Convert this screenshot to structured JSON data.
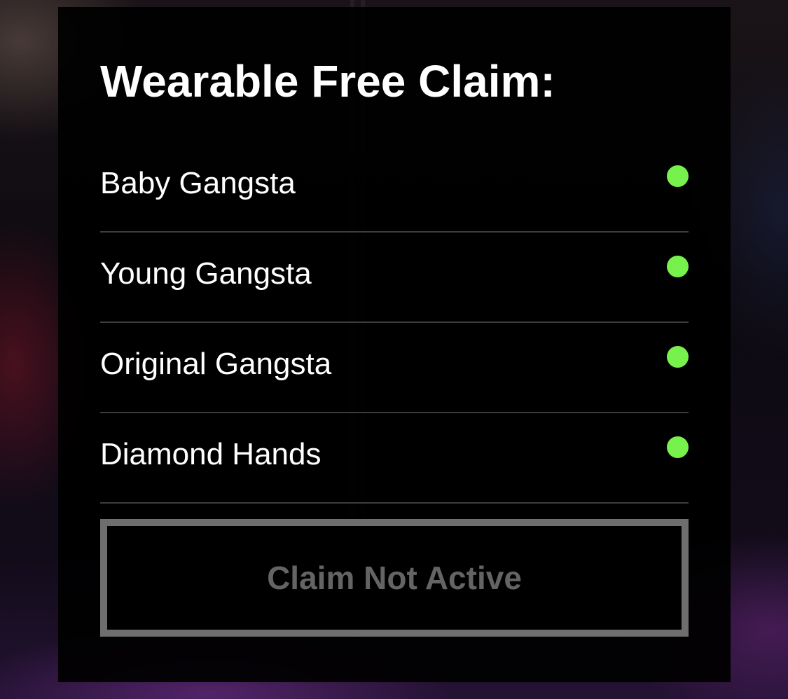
{
  "panel": {
    "title": "Wearable Free Claim:"
  },
  "items": [
    {
      "label": "Baby Gangsta",
      "status_color": "#77f14c"
    },
    {
      "label": "Young Gangsta",
      "status_color": "#77f14c"
    },
    {
      "label": "Original Gangsta",
      "status_color": "#77f14c"
    },
    {
      "label": "Diamond Hands",
      "status_color": "#77f14c"
    }
  ],
  "claim_button": {
    "label": "Claim Not Active",
    "disabled": true
  },
  "colors": {
    "status_active": "#77f14c",
    "divider": "#3c3c3c",
    "button_border": "#6e6e6e",
    "button_text": "#646464"
  },
  "icons": {
    "status": "status-dot-icon"
  }
}
